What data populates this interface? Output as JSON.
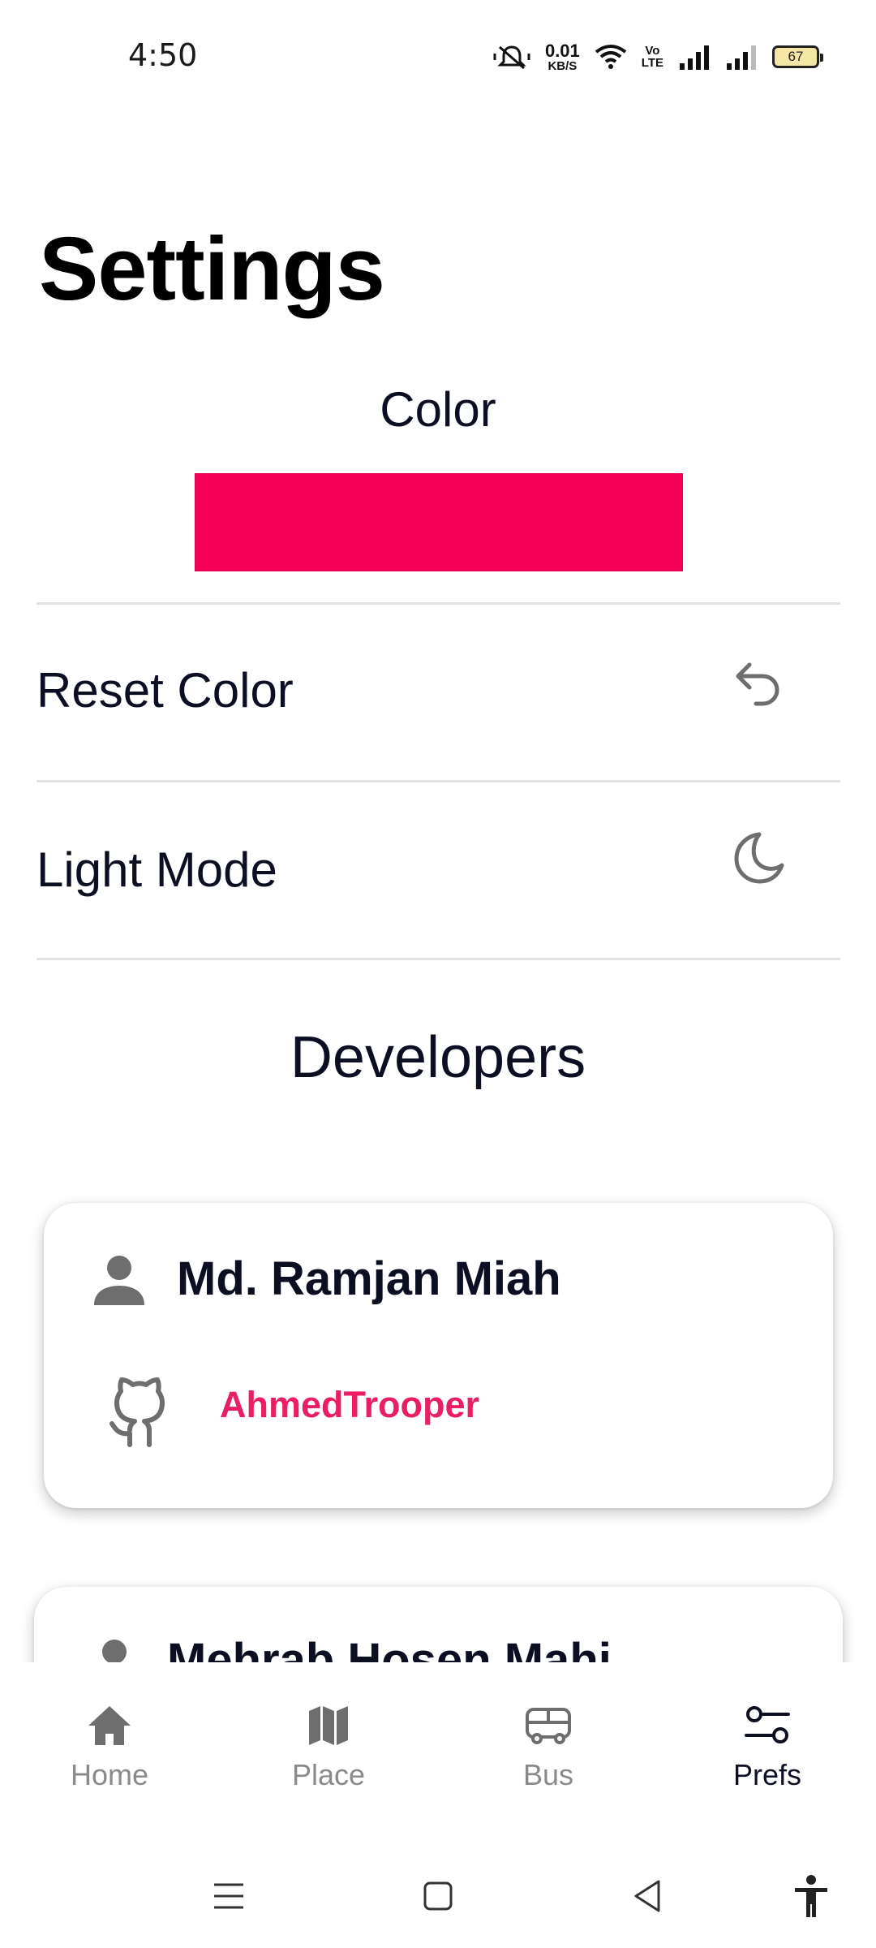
{
  "status_bar": {
    "time": "4:50",
    "net_speed_value": "0.01",
    "net_speed_unit": "KB/S",
    "volte_top": "Vo",
    "volte_bottom": "LTE",
    "battery_level": "67",
    "icons": [
      "mute-icon",
      "wifi-icon",
      "signal-icon",
      "signal-icon",
      "battery-icon"
    ]
  },
  "page": {
    "title": "Settings"
  },
  "color_section": {
    "heading": "Color",
    "swatch_color": "#f50057"
  },
  "settings_rows": [
    {
      "label": "Reset Color",
      "icon": "undo-icon"
    },
    {
      "label": "Light Mode",
      "icon": "moon-icon"
    }
  ],
  "developers": {
    "heading": "Developers",
    "cards": [
      {
        "name": "Md. Ramjan Miah",
        "github": "AhmedTrooper"
      },
      {
        "name": "Mehrab Hosen Mahi"
      }
    ]
  },
  "bottom_nav": {
    "items": [
      {
        "label": "Home",
        "icon": "home-icon"
      },
      {
        "label": "Place",
        "icon": "map-icon"
      },
      {
        "label": "Bus",
        "icon": "bus-icon"
      },
      {
        "label": "Prefs",
        "icon": "sliders-icon"
      }
    ],
    "active": "Prefs"
  },
  "system_nav": {
    "buttons": [
      "menu-icon",
      "home-square-icon",
      "back-icon",
      "accessibility-icon"
    ]
  },
  "colors": {
    "accent": "#f50057",
    "link": "#e91e63",
    "text": "#0c0f22",
    "icon_gray": "#6e6e6e"
  }
}
